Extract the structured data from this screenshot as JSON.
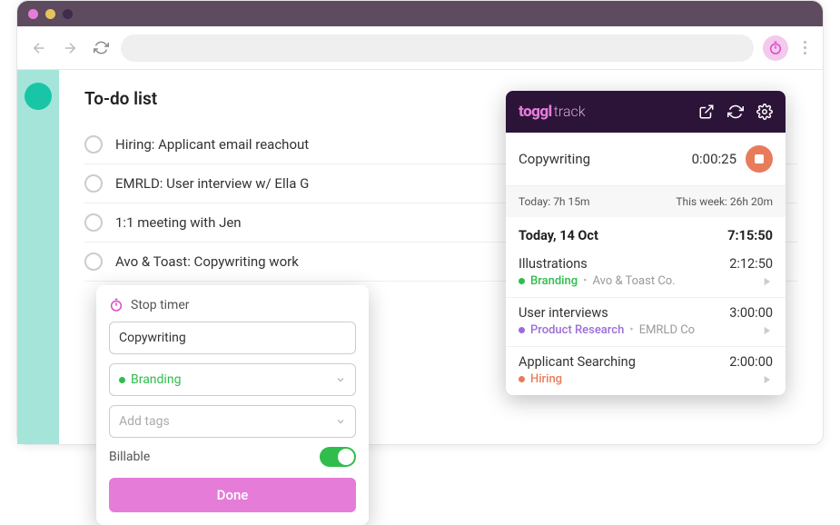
{
  "todo": {
    "title": "To-do list",
    "items": [
      "Hiring: Applicant email reachout",
      "EMRLD: User interview w/ Ella G",
      "1:1 meeting with Jen",
      "Avo & Toast: Copywriting work"
    ]
  },
  "popover": {
    "title": "Stop timer",
    "description_value": "Copywriting",
    "project_name": "Branding",
    "tags_placeholder": "Add tags",
    "billable_label": "Billable",
    "done_label": "Done"
  },
  "ext": {
    "logo_toggl": "toggl",
    "logo_track": "track",
    "running": {
      "desc": "Copywriting",
      "time": "0:00:25"
    },
    "summary": {
      "today": "Today: 7h 15m",
      "week": "This week: 26h 20m"
    },
    "date": {
      "label": "Today, 14 Oct",
      "total": "7:15:50"
    },
    "entries": [
      {
        "desc": "Illustrations",
        "time": "2:12:50",
        "project": "Branding",
        "color": "#2fbd4c",
        "company": "Avo & Toast Co."
      },
      {
        "desc": "User interviews",
        "time": "3:00:00",
        "project": "Product Research",
        "color": "#9b6dd7",
        "company": "EMRLD Co"
      },
      {
        "desc": "Applicant Searching",
        "time": "2:00:00",
        "project": "Hiring",
        "color": "#e87b5a",
        "company": ""
      }
    ]
  }
}
